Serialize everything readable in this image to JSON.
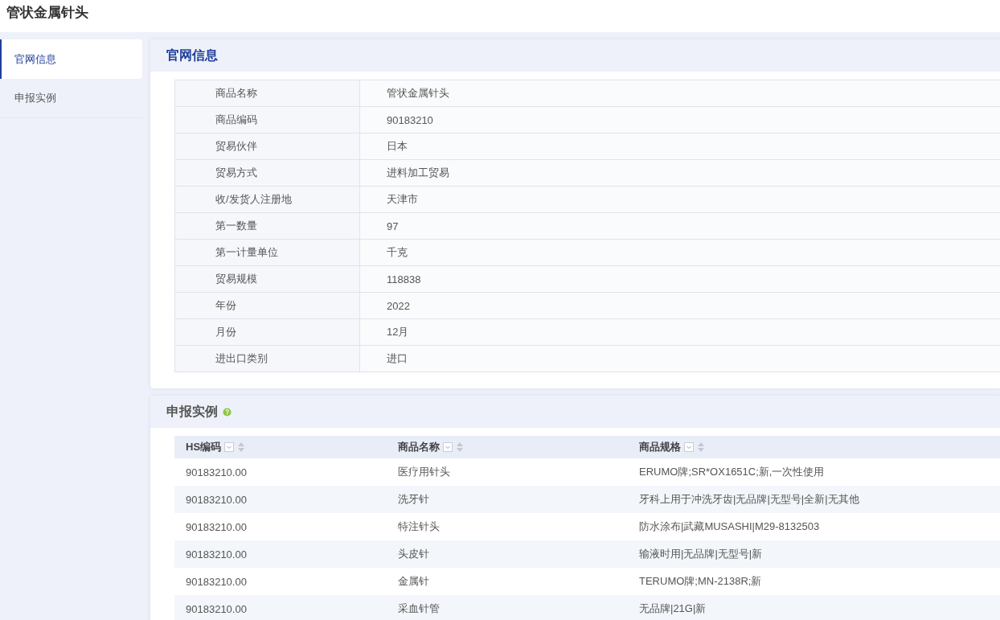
{
  "page_title": "管状金属针头",
  "sidebar": {
    "items": [
      {
        "label": "官网信息",
        "selected": true
      },
      {
        "label": "申报实例",
        "selected": false
      }
    ]
  },
  "official_info": {
    "title": "官网信息",
    "rows": [
      {
        "label": "商品名称",
        "value": "管状金属针头"
      },
      {
        "label": "商品编码",
        "value": "90183210"
      },
      {
        "label": "贸易伙伴",
        "value": "日本"
      },
      {
        "label": "贸易方式",
        "value": "进料加工贸易"
      },
      {
        "label": "收/发货人注册地",
        "value": "天津市"
      },
      {
        "label": "第一数量",
        "value": "97"
      },
      {
        "label": "第一计量单位",
        "value": "千克"
      },
      {
        "label": "贸易规模",
        "value": "118838"
      },
      {
        "label": "年份",
        "value": "2022"
      },
      {
        "label": "月份",
        "value": "12月"
      },
      {
        "label": "进出口类别",
        "value": "进口"
      }
    ]
  },
  "declarations": {
    "title": "申报实例",
    "columns": [
      "HS编码",
      "商品名称",
      "商品规格"
    ],
    "rows": [
      [
        "90183210.00",
        "医疗用针头",
        "ERUMO牌;SR*OX1651C;新,一次性使用"
      ],
      [
        "90183210.00",
        "洗牙针",
        "牙科上用于冲洗牙齿|无品牌|无型号|全新|无其他"
      ],
      [
        "90183210.00",
        "特注针头",
        "防水涂布|武藏MUSASHI|M29-8132503"
      ],
      [
        "90183210.00",
        "头皮针",
        "输液时用|无品牌|无型号|新"
      ],
      [
        "90183210.00",
        "金属针",
        "TERUMO牌;MN-2138R;新"
      ],
      [
        "90183210.00",
        "采血针管",
        "无品牌|21G|新"
      ]
    ]
  }
}
